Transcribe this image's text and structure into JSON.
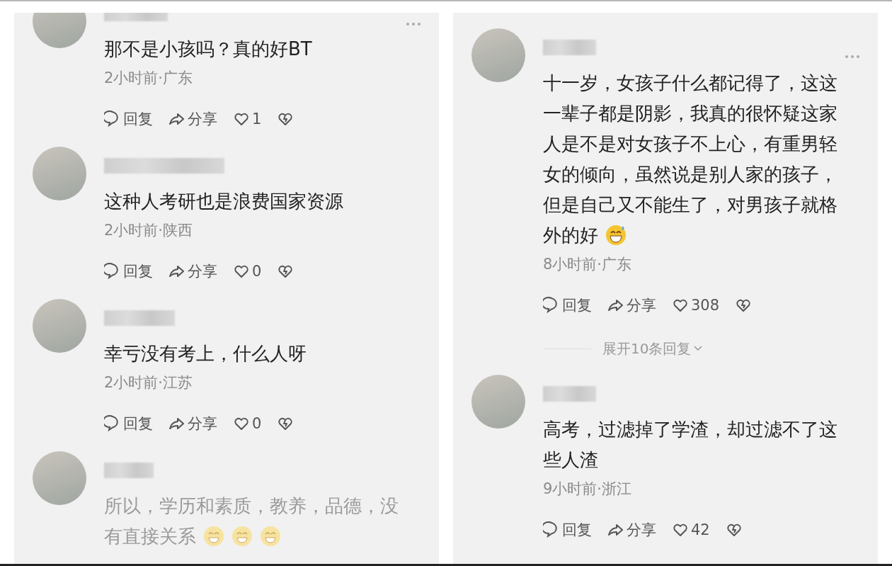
{
  "columns": [
    {
      "comments": [
        {
          "text": "那不是小孩吗？真的好BT",
          "meta": "2小时前·广东",
          "reply": "回复",
          "share": "分享",
          "likes": "1",
          "menu": true,
          "faded": false
        },
        {
          "text": "这种人考研也是浪费国家资源",
          "meta": "2小时前·陕西",
          "reply": "回复",
          "share": "分享",
          "likes": "0",
          "menu": false,
          "faded": false
        },
        {
          "text": "幸亏没有考上，什么人呀",
          "meta": "2小时前·江苏",
          "reply": "回复",
          "share": "分享",
          "likes": "0",
          "menu": false,
          "faded": false
        },
        {
          "text": "所以，学历和素质，教养，品德，没有直接关系",
          "emojis": [
            {
              "kind": "grin"
            },
            {
              "kind": "grin"
            },
            {
              "kind": "grin"
            }
          ],
          "menu": false,
          "faded": true
        }
      ]
    },
    {
      "comments": [
        {
          "text": "十一岁，女孩子什么都记得了，这这一辈子都是阴影，我真的很怀疑这家人是不是对女孩子不上心，有重男轻女的倾向，虽然说是别人家的孩子，但是自己又不能生了，对男孩子就格外的好",
          "emojis": [
            {
              "kind": "sweat"
            }
          ],
          "meta": "8小时前·广东",
          "reply": "回复",
          "share": "分享",
          "likes": "308",
          "menu": true,
          "faded": false,
          "expand": "展开10条回复"
        },
        {
          "text": "高考，过滤掉了学渣，却过滤不了这些人渣",
          "meta": "9小时前·浙江",
          "reply": "回复",
          "share": "分享",
          "likes": "42",
          "menu": false,
          "faded": false
        }
      ]
    }
  ]
}
